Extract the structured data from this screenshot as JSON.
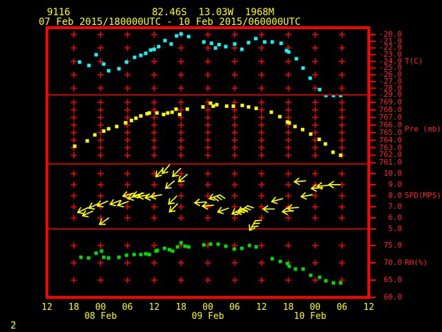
{
  "header": {
    "station_id": "9116",
    "location": "82.46S  13.03W  1968M",
    "period": "07 Feb 2015/180000UTC - 10 Feb 2015/060000UTC"
  },
  "footer": {
    "page_number": "2"
  },
  "colors": {
    "background": "#000000",
    "grid_red": "#ff0000",
    "label_red": "#ff2222",
    "yellow": "#ffff00",
    "cyan": "#00ffff",
    "green": "#00e000"
  },
  "x_axis": {
    "tick_labels": [
      "12",
      "18",
      "00",
      "06",
      "12",
      "18",
      "00",
      "06",
      "12",
      "18",
      "00",
      "06",
      "12"
    ],
    "date_labels": [
      "08 Feb",
      "09 Feb",
      "10 Feb"
    ]
  },
  "panels": [
    {
      "id": "temperature",
      "unit_label": "T(C)",
      "tick_labels": [
        "-20.0",
        "-21.0",
        "-22.0",
        "-23.0",
        "-24.0",
        "-25.0",
        "-26.0",
        "-27.0",
        "-28.0",
        "-29.0"
      ]
    },
    {
      "id": "pressure",
      "unit_label": "Pre (mb)",
      "tick_labels": [
        "769.0",
        "768.0",
        "767.0",
        "766.0",
        "765.0",
        "764.0",
        "763.0",
        "762.0",
        "761.0"
      ]
    },
    {
      "id": "wind",
      "unit_label": "SPD(MPS)",
      "tick_labels": [
        "10.0",
        "9.0",
        "8.0",
        "7.0",
        "6.0",
        "5.0"
      ]
    },
    {
      "id": "rh",
      "unit_label": "RH(%)",
      "tick_labels": [
        "75.0",
        "70.0",
        "65.0",
        "60.0"
      ]
    }
  ],
  "chart_data": [
    {
      "type": "scatter",
      "id": "temperature",
      "name": "T(C)",
      "color": "#00ffff",
      "x_unit": "hours from axis start (axis ticks every 6h, 12UTC to 12UTC)",
      "x_range_hours": [
        0,
        72
      ],
      "ylim": [
        -29,
        -20
      ],
      "points": [
        [
          7.3,
          -24.1
        ],
        [
          9.4,
          -24.6
        ],
        [
          11.0,
          -23.0
        ],
        [
          12.7,
          -24.4
        ],
        [
          13.8,
          -25.4
        ],
        [
          16.1,
          -25.1
        ],
        [
          17.8,
          -24.1
        ],
        [
          19.6,
          -23.4
        ],
        [
          21.0,
          -23.1
        ],
        [
          22.1,
          -22.8
        ],
        [
          23.2,
          -22.3
        ],
        [
          24.0,
          -22.2
        ],
        [
          25.0,
          -21.8
        ],
        [
          26.4,
          -20.9
        ],
        [
          27.8,
          -21.4
        ],
        [
          29.0,
          -20.2
        ],
        [
          30.0,
          -19.9
        ],
        [
          31.7,
          -20.3
        ],
        [
          35.1,
          -21.1
        ],
        [
          36.8,
          -21.3
        ],
        [
          37.7,
          -22.0
        ],
        [
          38.5,
          -21.5
        ],
        [
          40.0,
          -21.8
        ],
        [
          42.0,
          -21.4
        ],
        [
          43.6,
          -22.2
        ],
        [
          45.1,
          -21.2
        ],
        [
          46.7,
          -20.6
        ],
        [
          48.7,
          -21.1
        ],
        [
          50.4,
          -21.1
        ],
        [
          52.4,
          -21.3
        ],
        [
          53.6,
          -22.4
        ],
        [
          54.1,
          -22.6
        ],
        [
          55.8,
          -23.6
        ],
        [
          57.3,
          -25.0
        ],
        [
          58.9,
          -26.5
        ],
        [
          61.0,
          -28.2
        ],
        [
          62.4,
          -29.2
        ],
        [
          64.1,
          -29.2
        ],
        [
          65.7,
          -29.2
        ]
      ]
    },
    {
      "type": "scatter",
      "id": "pressure",
      "name": "Pre (mb)",
      "color": "#ffff00",
      "x_range_hours": [
        0,
        72
      ],
      "ylim": [
        761,
        770
      ],
      "points": [
        [
          6.2,
          763.2
        ],
        [
          9.0,
          763.9
        ],
        [
          10.7,
          764.7
        ],
        [
          12.7,
          765.2
        ],
        [
          13.8,
          765.5
        ],
        [
          15.6,
          765.8
        ],
        [
          17.6,
          766.3
        ],
        [
          18.9,
          766.6
        ],
        [
          19.9,
          766.9
        ],
        [
          21.0,
          767.2
        ],
        [
          22.4,
          767.5
        ],
        [
          22.9,
          767.6
        ],
        [
          24.6,
          767.6
        ],
        [
          26.1,
          767.4
        ],
        [
          27.0,
          767.6
        ],
        [
          28.0,
          767.7
        ],
        [
          28.9,
          768.1
        ],
        [
          29.7,
          767.4
        ],
        [
          31.4,
          768.1
        ],
        [
          34.9,
          768.4
        ],
        [
          36.6,
          768.9
        ],
        [
          37.2,
          768.5
        ],
        [
          38.0,
          768.7
        ],
        [
          40.2,
          768.5
        ],
        [
          41.7,
          768.5
        ],
        [
          43.7,
          768.6
        ],
        [
          45.1,
          768.4
        ],
        [
          46.8,
          768.2
        ],
        [
          50.2,
          767.7
        ],
        [
          52.1,
          767.1
        ],
        [
          53.8,
          766.4
        ],
        [
          54.2,
          766.3
        ],
        [
          55.5,
          765.8
        ],
        [
          57.2,
          765.4
        ],
        [
          59.0,
          764.8
        ],
        [
          60.9,
          764.1
        ],
        [
          62.3,
          763.5
        ],
        [
          64.0,
          762.4
        ],
        [
          65.7,
          762.0
        ]
      ]
    },
    {
      "type": "wind_arrows",
      "id": "wind",
      "name": "SPD(MPS)",
      "color": "#ffff00",
      "x_range_hours": [
        0,
        72
      ],
      "ylim": [
        5,
        11
      ],
      "note": "points are [t_hours, speed_mps, arrow_rotation_deg_svg, feathered]",
      "points": [
        [
          8.0,
          6.7,
          155,
          0
        ],
        [
          9.1,
          6.4,
          155,
          0
        ],
        [
          10.5,
          7.1,
          155,
          0
        ],
        [
          12.4,
          7.3,
          155,
          0
        ],
        [
          12.8,
          5.7,
          145,
          0
        ],
        [
          15.3,
          7.4,
          160,
          0
        ],
        [
          17.0,
          7.3,
          160,
          0
        ],
        [
          18.2,
          8.1,
          165,
          0
        ],
        [
          19.3,
          7.9,
          160,
          0
        ],
        [
          20.4,
          8.1,
          165,
          0
        ],
        [
          21.6,
          8.0,
          170,
          0
        ],
        [
          23.2,
          7.9,
          170,
          0
        ],
        [
          24.4,
          8.0,
          170,
          0
        ],
        [
          25.2,
          10.1,
          130,
          0
        ],
        [
          26.6,
          10.4,
          130,
          0
        ],
        [
          27.5,
          9.0,
          140,
          0
        ],
        [
          28.1,
          7.6,
          135,
          0
        ],
        [
          28.3,
          6.9,
          135,
          0
        ],
        [
          29.0,
          10.1,
          135,
          0
        ],
        [
          30.4,
          9.6,
          140,
          0
        ],
        [
          34.3,
          7.4,
          175,
          0
        ],
        [
          36.0,
          7.1,
          175,
          0
        ],
        [
          37.5,
          7.9,
          160,
          1
        ],
        [
          39.4,
          6.7,
          160,
          0
        ],
        [
          42.5,
          6.6,
          150,
          1
        ],
        [
          43.9,
          6.8,
          145,
          1
        ],
        [
          46.0,
          5.3,
          120,
          1
        ],
        [
          49.6,
          6.8,
          180,
          0
        ],
        [
          51.5,
          7.6,
          165,
          0
        ],
        [
          53.9,
          6.6,
          175,
          0
        ],
        [
          55.0,
          6.9,
          175,
          0
        ],
        [
          56.6,
          9.3,
          175,
          0
        ],
        [
          58.1,
          8.0,
          170,
          0
        ],
        [
          60.4,
          8.7,
          175,
          0
        ],
        [
          61.7,
          8.9,
          175,
          0
        ],
        [
          64.3,
          9.0,
          180,
          0
        ]
      ]
    },
    {
      "type": "scatter",
      "id": "rh",
      "name": "RH(%)",
      "color": "#00e000",
      "x_range_hours": [
        0,
        72
      ],
      "ylim": [
        60,
        80
      ],
      "points": [
        [
          7.6,
          71.6
        ],
        [
          9.3,
          71.4
        ],
        [
          11.0,
          72.8
        ],
        [
          12.2,
          73.4
        ],
        [
          12.7,
          71.6
        ],
        [
          13.8,
          71.4
        ],
        [
          16.1,
          71.6
        ],
        [
          17.8,
          72.2
        ],
        [
          19.5,
          72.4
        ],
        [
          21.0,
          72.4
        ],
        [
          22.1,
          72.6
        ],
        [
          22.9,
          72.4
        ],
        [
          24.4,
          73.4
        ],
        [
          24.7,
          73.6
        ],
        [
          26.3,
          74.2
        ],
        [
          27.4,
          73.8
        ],
        [
          28.1,
          73.4
        ],
        [
          29.2,
          74.6
        ],
        [
          30.0,
          75.8
        ],
        [
          30.9,
          74.8
        ],
        [
          31.7,
          74.6
        ],
        [
          35.1,
          75.2
        ],
        [
          36.6,
          75.4
        ],
        [
          38.3,
          75.4
        ],
        [
          40.0,
          74.8
        ],
        [
          41.9,
          74.0
        ],
        [
          43.6,
          74.2
        ],
        [
          45.3,
          75.0
        ],
        [
          46.8,
          74.6
        ],
        [
          50.4,
          71.2
        ],
        [
          52.2,
          70.4
        ],
        [
          53.8,
          69.8
        ],
        [
          54.2,
          69.0
        ],
        [
          55.6,
          68.2
        ],
        [
          57.3,
          68.2
        ],
        [
          59.0,
          66.4
        ],
        [
          61.0,
          65.8
        ],
        [
          62.4,
          64.8
        ],
        [
          64.1,
          64.2
        ],
        [
          65.7,
          64.2
        ]
      ]
    }
  ]
}
